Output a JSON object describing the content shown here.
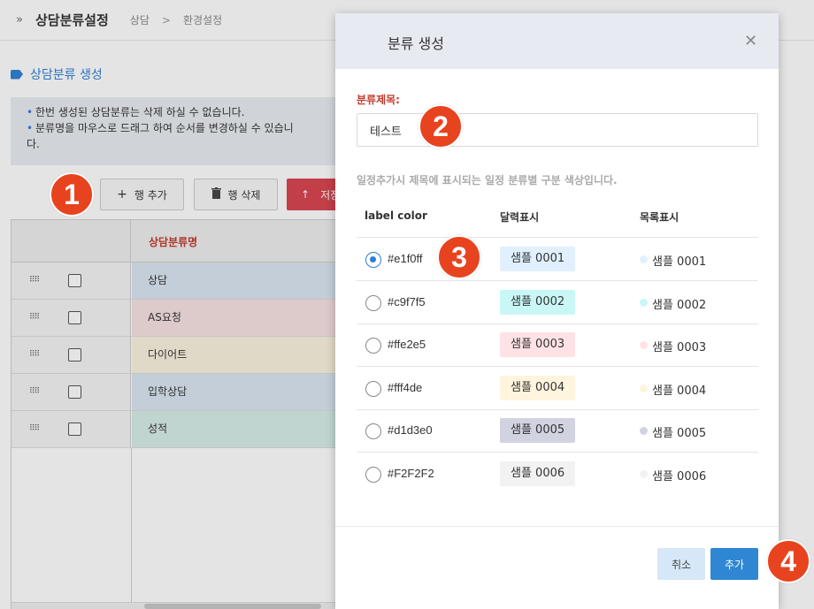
{
  "header": {
    "title": "상담분류설정",
    "breadcrumb": [
      "상담",
      "환경설정"
    ]
  },
  "section": {
    "title": "상담분류 생성",
    "notices": [
      "한번 생성된 상담분류는 삭제 하실 수 없습니다.",
      "분류명을 마우스로 드래그 하여 순서를 변경하실 수 있습니",
      "다."
    ]
  },
  "toolbar": {
    "add_label": "행 추가",
    "delete_label": "행 삭제",
    "save_label": "저장"
  },
  "grid": {
    "column_header": "상담분류명",
    "rows": [
      {
        "name": "상담",
        "color": "#dbe6f2"
      },
      {
        "name": "AS요청",
        "color": "#f8e2e3"
      },
      {
        "name": "다이어트",
        "color": "#fcf3df"
      },
      {
        "name": "입학상담",
        "color": "#dbe6f2"
      },
      {
        "name": "성적",
        "color": "#d6ede9"
      }
    ]
  },
  "modal": {
    "title": "분류 생성",
    "close_icon": "close-icon",
    "field_label": "분류제목:",
    "field_value": "테스트",
    "help_text": "일정추가시 제목에 표시되는 일정 분류별 구분 색상입니다.",
    "columns": [
      "label color",
      "달력표시",
      "목록표시"
    ],
    "colors": [
      {
        "code": "#e1f0ff",
        "sample": "샘플 0001",
        "list": "샘플 0001",
        "hex": "#e1f0ff",
        "selected": true
      },
      {
        "code": "#c9f7f5",
        "sample": "샘플 0002",
        "list": "샘플 0002",
        "hex": "#c9f7f5",
        "selected": false
      },
      {
        "code": "#ffe2e5",
        "sample": "샘플 0003",
        "list": "샘플 0003",
        "hex": "#ffe2e5",
        "selected": false
      },
      {
        "code": "#fff4de",
        "sample": "샘플 0004",
        "list": "샘플 0004",
        "hex": "#fff4de",
        "selected": false
      },
      {
        "code": "#d1d3e0",
        "sample": "샘플 0005",
        "list": "샘플 0005",
        "hex": "#d1d3e0",
        "selected": false
      },
      {
        "code": "#F2F2F2",
        "sample": "샘플 0006",
        "list": "샘플 0006",
        "hex": "#F2F2F2",
        "selected": false
      }
    ],
    "cancel_label": "취소",
    "add_label": "추가"
  },
  "badges": [
    "1",
    "2",
    "3",
    "4"
  ],
  "accent": "#2e7fd6",
  "badge_color": "#e8431f"
}
